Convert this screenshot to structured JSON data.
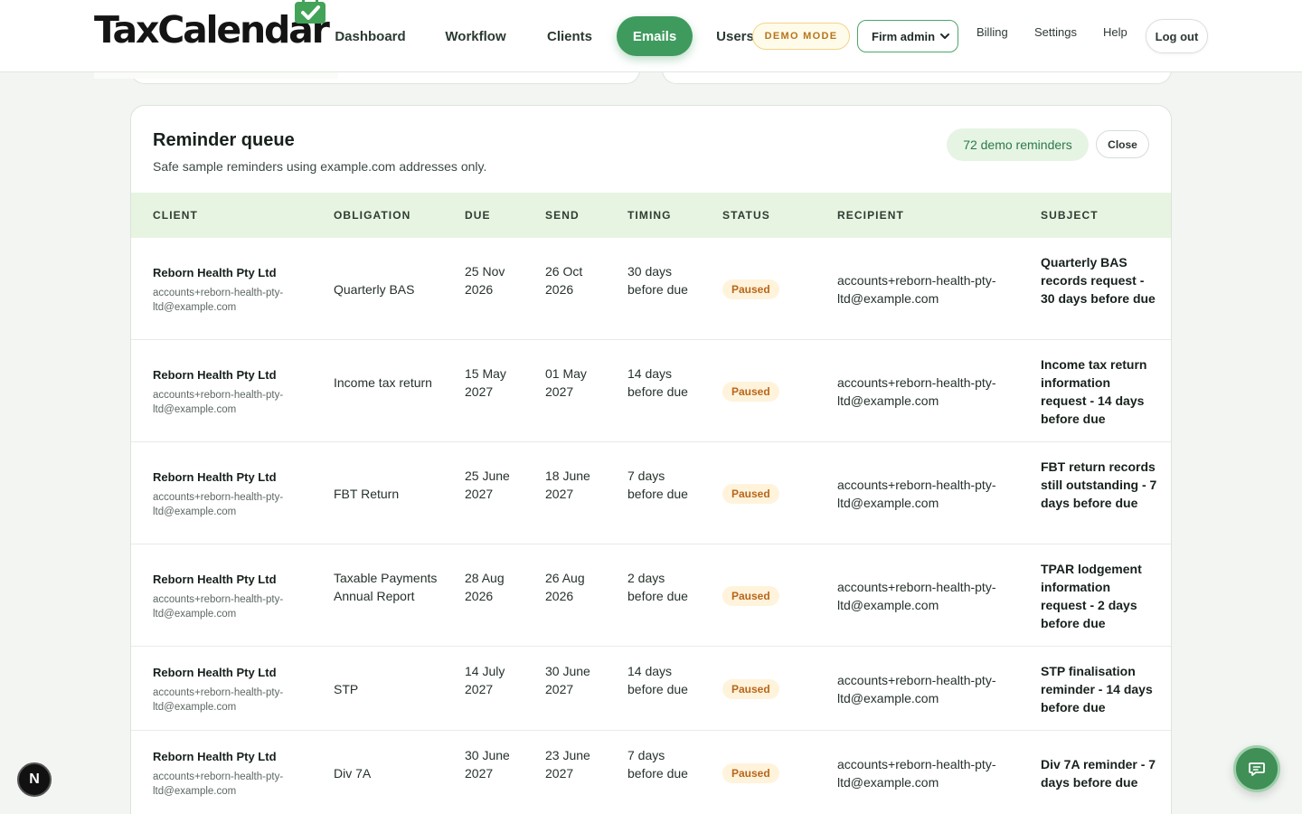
{
  "header": {
    "logo_text": "TaxCalendar",
    "nav": [
      "Dashboard",
      "Workflow",
      "Clients",
      "Emails",
      "Users"
    ],
    "active_nav": "Emails",
    "demo_badge": "DEMO MODE",
    "role_selected": "Firm admin",
    "links": [
      "Billing",
      "Settings",
      "Help"
    ],
    "logout_label": "Log out"
  },
  "panel": {
    "title": "Reminder queue",
    "subtitle": "Safe sample reminders using example.com addresses only.",
    "count_label": "72 demo reminders",
    "close_label": "Close",
    "columns": [
      "CLIENT",
      "OBLIGATION",
      "DUE",
      "SEND",
      "TIMING",
      "STATUS",
      "RECIPIENT",
      "SUBJECT"
    ],
    "rows": [
      {
        "client": "Reborn Health Pty Ltd",
        "client_email": "accounts+reborn-health-pty-ltd@example.com",
        "obligation": "Quarterly BAS",
        "due": "25 Nov 2026",
        "send": "26 Oct 2026",
        "timing": "30 days before due",
        "status": "Paused",
        "recipient": "accounts+reborn-health-pty-ltd@example.com",
        "subject": "Quarterly BAS records request - 30 days before due"
      },
      {
        "client": "Reborn Health Pty Ltd",
        "client_email": "accounts+reborn-health-pty-ltd@example.com",
        "obligation": "Income tax return",
        "due": "15 May 2027",
        "send": "01 May 2027",
        "timing": "14 days before due",
        "status": "Paused",
        "recipient": "accounts+reborn-health-pty-ltd@example.com",
        "subject": "Income tax return information request - 14 days before due"
      },
      {
        "client": "Reborn Health Pty Ltd",
        "client_email": "accounts+reborn-health-pty-ltd@example.com",
        "obligation": "FBT Return",
        "due": "25 June 2027",
        "send": "18 June 2027",
        "timing": "7 days before due",
        "status": "Paused",
        "recipient": "accounts+reborn-health-pty-ltd@example.com",
        "subject": "FBT return records still outstanding - 7 days before due"
      },
      {
        "client": "Reborn Health Pty Ltd",
        "client_email": "accounts+reborn-health-pty-ltd@example.com",
        "obligation": "Taxable Payments Annual Report",
        "due": "28 Aug 2026",
        "send": "26 Aug 2026",
        "timing": "2 days before due",
        "status": "Paused",
        "recipient": "accounts+reborn-health-pty-ltd@example.com",
        "subject": "TPAR lodgement information request - 2 days before due"
      },
      {
        "client": "Reborn Health Pty Ltd",
        "client_email": "accounts+reborn-health-pty-ltd@example.com",
        "obligation": "STP",
        "due": "14 July 2027",
        "send": "30 June 2027",
        "timing": "14 days before due",
        "status": "Paused",
        "recipient": "accounts+reborn-health-pty-ltd@example.com",
        "subject": "STP finalisation reminder - 14 days before due"
      },
      {
        "client": "Reborn Health Pty Ltd",
        "client_email": "accounts+reborn-health-pty-ltd@example.com",
        "obligation": "Div 7A",
        "due": "30 June 2027",
        "send": "23 June 2027",
        "timing": "7 days before due",
        "status": "Paused",
        "recipient": "accounts+reborn-health-pty-ltd@example.com",
        "subject": "Div 7A reminder - 7 days before due"
      }
    ]
  },
  "floating": {
    "dev_badge": "N",
    "chat_icon": "chat-bubble-icon"
  },
  "colors": {
    "brand_green": "#3f9a5e",
    "header_bg": "#e7f4e2",
    "status_paused": "#b9661a"
  }
}
